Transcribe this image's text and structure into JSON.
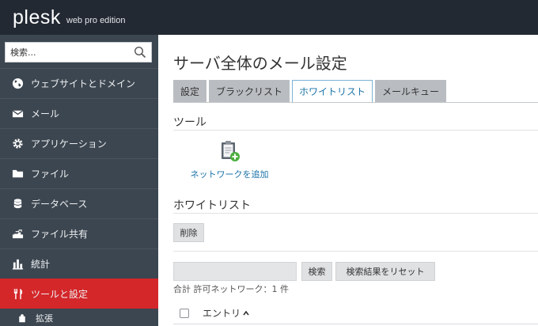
{
  "brand": {
    "logo": "plesk",
    "edition": "web pro edition"
  },
  "sidebar": {
    "search_placeholder": "検索...",
    "items": [
      {
        "label": "ウェブサイトとドメイン",
        "icon": "globe-icon"
      },
      {
        "label": "メール",
        "icon": "envelope-icon"
      },
      {
        "label": "アプリケーション",
        "icon": "gear-icon"
      },
      {
        "label": "ファイル",
        "icon": "folder-icon"
      },
      {
        "label": "データベース",
        "icon": "database-icon"
      },
      {
        "label": "ファイル共有",
        "icon": "share-icon"
      },
      {
        "label": "統計",
        "icon": "bar-chart-icon"
      },
      {
        "label": "ツールと設定",
        "icon": "tools-icon",
        "active": true
      },
      {
        "label": "拡張",
        "icon": "puzzle-icon"
      }
    ]
  },
  "main": {
    "title": "サーバ全体のメール設定",
    "tabs": [
      {
        "label": "設定"
      },
      {
        "label": "ブラックリスト"
      },
      {
        "label": "ホワイトリスト",
        "active": true
      },
      {
        "label": "メールキュー"
      }
    ],
    "tools_section": {
      "title": "ツール",
      "add_network_label": "ネットワークを追加"
    },
    "whitelist_section": {
      "title": "ホワイトリスト",
      "delete_label": "削除",
      "search_button_label": "検索",
      "reset_button_label": "検索結果をリセット",
      "search_value": "",
      "count_text": "合計 許可ネットワーク：1 件",
      "column_entry": "エントリ"
    }
  },
  "colors": {
    "topbar": "#222933",
    "sidebar": "#3c4650",
    "active_nav": "#d4272a",
    "link": "#1a73a8"
  }
}
